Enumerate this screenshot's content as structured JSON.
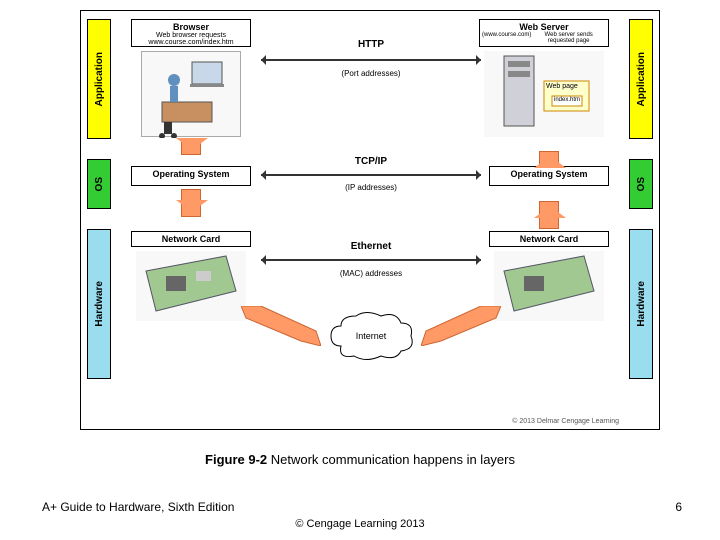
{
  "labels": {
    "app": "Application",
    "os": "OS",
    "hw": "Hardware"
  },
  "client": {
    "browser": "Browser",
    "browser_sub": "Web browser requests www.course.com/index.htm",
    "os": "Operating System",
    "nic": "Network Card"
  },
  "server": {
    "webserver": "Web Server",
    "webserver_sub": "Web server sends requested page",
    "webpage": "Web page",
    "indexfile": "index.htm",
    "url": "(www.course.com)",
    "os": "Operating System",
    "nic": "Network Card"
  },
  "protocols": {
    "http": "HTTP",
    "http_sub": "(Port addresses)",
    "tcpip": "TCP/IP",
    "tcpip_sub": "(IP addresses)",
    "ethernet": "Ethernet",
    "ethernet_sub": "(MAC) addresses",
    "internet": "Internet"
  },
  "caption_bold": "Figure 9-2",
  "caption_rest": " Network communication happens in layers",
  "footer_left": "A+ Guide to Hardware, Sixth Edition",
  "footer_center": "© Cengage Learning  2013",
  "page_num": "6",
  "diag_copyright": "© 2013 Delmar Cengage Learning"
}
